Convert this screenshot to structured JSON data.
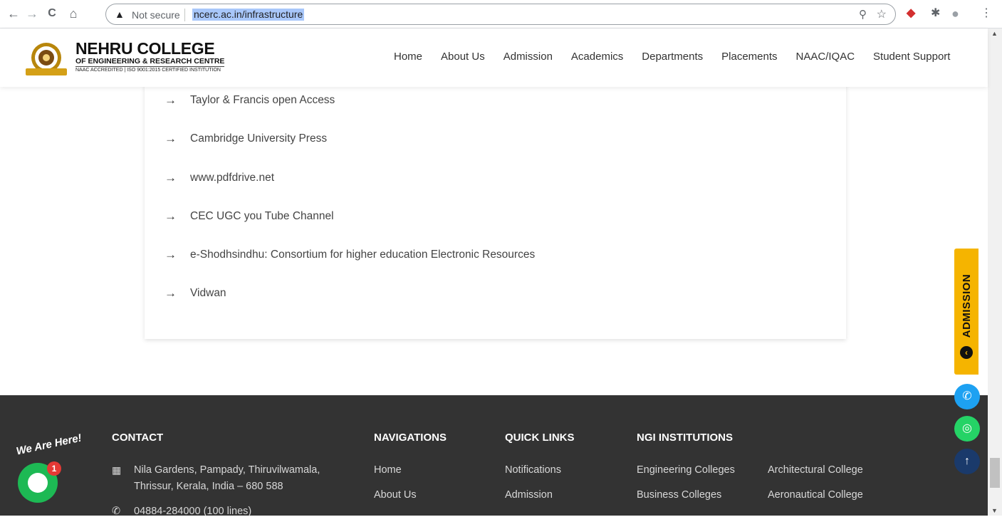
{
  "browser": {
    "back": "←",
    "forward": "→",
    "reload": "C",
    "home": "⌂",
    "security_label": "Not secure",
    "url": "ncerc.ac.in/infrastructure"
  },
  "header": {
    "logo_title": "NEHRU COLLEGE",
    "logo_subtitle": "OF ENGINEERING & RESEARCH CENTRE",
    "logo_cert": "NAAC ACCREDITED | ISO 9001:2015 CERTIFIED INSTITUTION",
    "nav": [
      "Home",
      "About Us",
      "Admission",
      "Academics",
      "Departments",
      "Placements",
      "NAAC/IQAC",
      "Student Support"
    ]
  },
  "resources": [
    "Taylor & Francis open Access",
    "Cambridge University Press",
    "www.pdfdrive.net",
    "CEC UGC you Tube Channel",
    "e-Shodhsindhu: Consortium for higher education Electronic Resources",
    "Vidwan"
  ],
  "footer": {
    "contact_heading": "CONTACT",
    "address_line1": "Nila Gardens, Pampady, Thiruvilwamala,",
    "address_line2": "Thrissur, Kerala, India – 680 588",
    "phone": "04884-284000 (100 lines)",
    "nav_heading": "NAVIGATIONS",
    "nav_links": [
      "Home",
      "About Us"
    ],
    "quick_heading": "QUICK LINKS",
    "quick_links": [
      "Notifications",
      "Admission"
    ],
    "ngi_heading": "NGI INSTITUTIONS",
    "ngi_col1": [
      "Engineering Colleges",
      "Business Colleges"
    ],
    "ngi_col2": [
      "Architectural College",
      "Aeronautical College"
    ]
  },
  "floating": {
    "admission_label": "ADMISSION",
    "chat_text": "We Are Here!",
    "chat_badge": "1"
  },
  "colors": {
    "admission_tab": "#f5b400",
    "phone_button": "#1da1f2",
    "whatsapp_button": "#25d366",
    "top_button": "#1a3a6b",
    "footer_bg": "#333333"
  }
}
